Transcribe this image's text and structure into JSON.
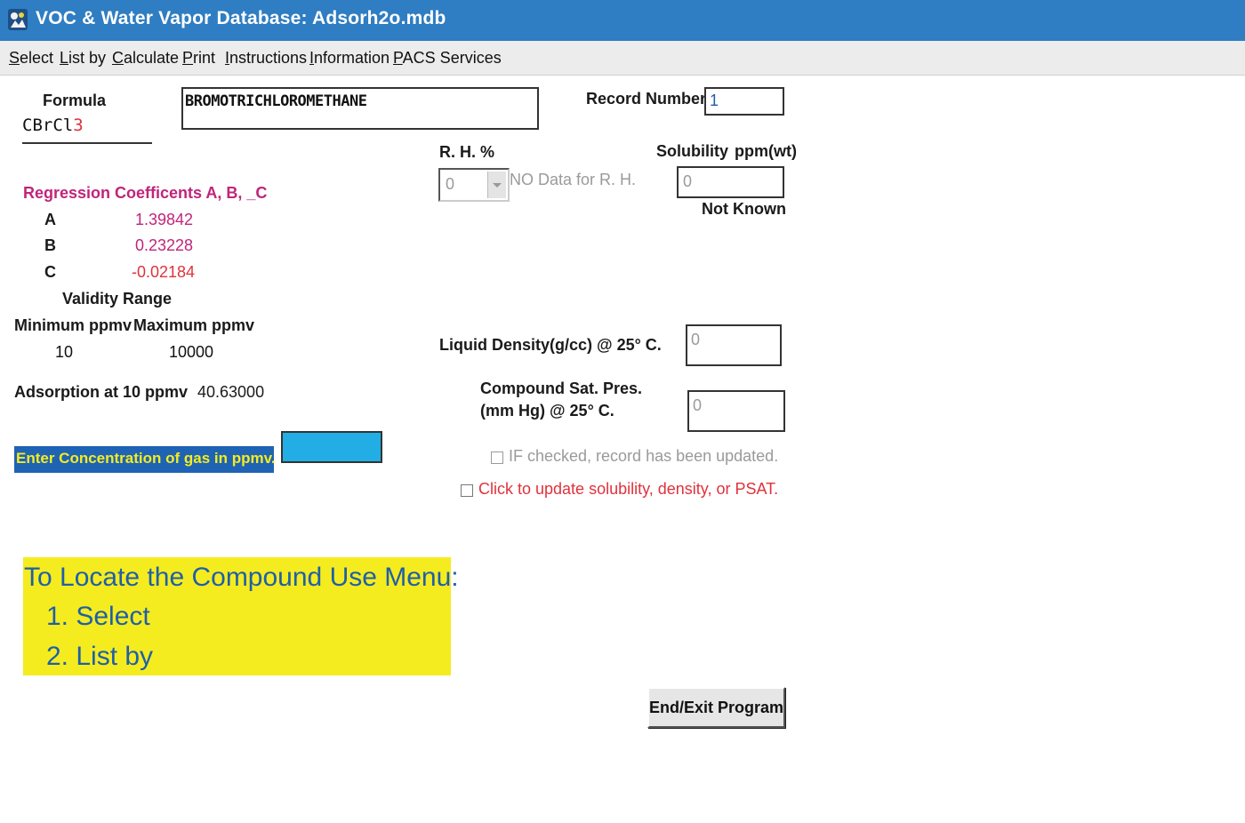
{
  "window": {
    "title": "VOC & Water Vapor Database: Adsorh2o.mdb",
    "icon": "app-icon"
  },
  "menu": [
    {
      "label": "Select",
      "accel": "S",
      "rest": "elect"
    },
    {
      "label": "List by",
      "accel": "L",
      "rest": "ist by"
    },
    {
      "label": "Calculate",
      "accel": "C",
      "rest": "alculate"
    },
    {
      "label": "Print",
      "accel": "P",
      "rest": "rint"
    },
    {
      "label": "Instructions",
      "accel": "I",
      "rest": "nstructions"
    },
    {
      "label": "Information",
      "accel": "I",
      "rest": "nformation"
    },
    {
      "label": "PACS Services",
      "accel": "P",
      "rest": "ACS Services"
    }
  ],
  "formula": {
    "label": "Formula",
    "prefix": "CBrCl",
    "subscript": "3"
  },
  "compound_name": "BROMOTRICHLOROMETHANE",
  "record": {
    "label": "Record Number",
    "value": "1"
  },
  "regression": {
    "title": "Regression Coefficents A, B, _C",
    "a_label": "A",
    "a_value": "1.39842",
    "b_label": "B",
    "b_value": "0.23228",
    "c_label": "C",
    "c_value": "-0.02184"
  },
  "validity": {
    "title": "Validity Range",
    "min_label": "Minimum ppmv",
    "max_label": "Maximum ppmv",
    "min_value": "10",
    "max_value": "10000"
  },
  "adsorption": {
    "label": "Adsorption at 10 ppmv",
    "value": "40.63000"
  },
  "concentration": {
    "label": "Enter Concentration of gas in ppmv.",
    "value": ""
  },
  "rh": {
    "label": "R. H. %",
    "value": "0",
    "note": "NO Data for R. H."
  },
  "solubility": {
    "label": "Solubility",
    "unit": "ppm(wt)",
    "value": "0",
    "status": "Not Known"
  },
  "liquid_density": {
    "label": "Liquid Density(g/cc) @ 25° C.",
    "value": "0"
  },
  "sat_pressure": {
    "label_line1": "Compound Sat. Pres.",
    "label_line2": "(mm Hg) @ 25° C.",
    "value": "0"
  },
  "checkbox_updated": {
    "label": "IF checked, record has been updated.",
    "checked": false
  },
  "checkbox_update": {
    "label": "Click to update solubility, density, or PSAT.",
    "checked": false
  },
  "help": {
    "heading": "To Locate the Compound Use Menu:",
    "step1": "1. Select",
    "step2": "2. List by"
  },
  "exit_button": "End/Exit Program",
  "colors": {
    "titlebar": "#2f7dc2",
    "help_bg": "#f5ec1f",
    "help_text": "#1f5fa8",
    "concentration_bg": "#1f63b5",
    "concentration_input": "#22aee4",
    "magenta": "#c0257a",
    "red": "#e0323c"
  }
}
